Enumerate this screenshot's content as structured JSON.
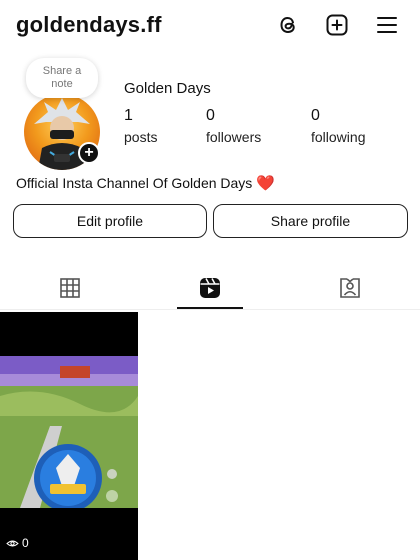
{
  "header": {
    "username": "goldendays.ff"
  },
  "icons": {
    "threads": "threads-icon",
    "create": "add-square-icon",
    "menu": "hamburger-menu-icon"
  },
  "profile": {
    "note_label": "Share a note",
    "display_name": "Golden Days",
    "stats": [
      {
        "value": "1",
        "label": "posts"
      },
      {
        "value": "0",
        "label": "followers"
      },
      {
        "value": "0",
        "label": "following"
      }
    ],
    "bio": "Official Insta Channel Of Golden Days",
    "bio_emoji": "❤️"
  },
  "actions": {
    "edit_label": "Edit profile",
    "share_label": "Share profile"
  },
  "tabs": [
    {
      "name": "grid",
      "icon": "grid-icon",
      "active": false
    },
    {
      "name": "reels",
      "icon": "reels-icon",
      "active": true
    },
    {
      "name": "tagged",
      "icon": "tagged-icon",
      "active": false
    }
  ],
  "reels": [
    {
      "views": "0"
    }
  ],
  "colors": {
    "heart": "#e8212f",
    "text": "#111111",
    "background": "#ffffff"
  }
}
